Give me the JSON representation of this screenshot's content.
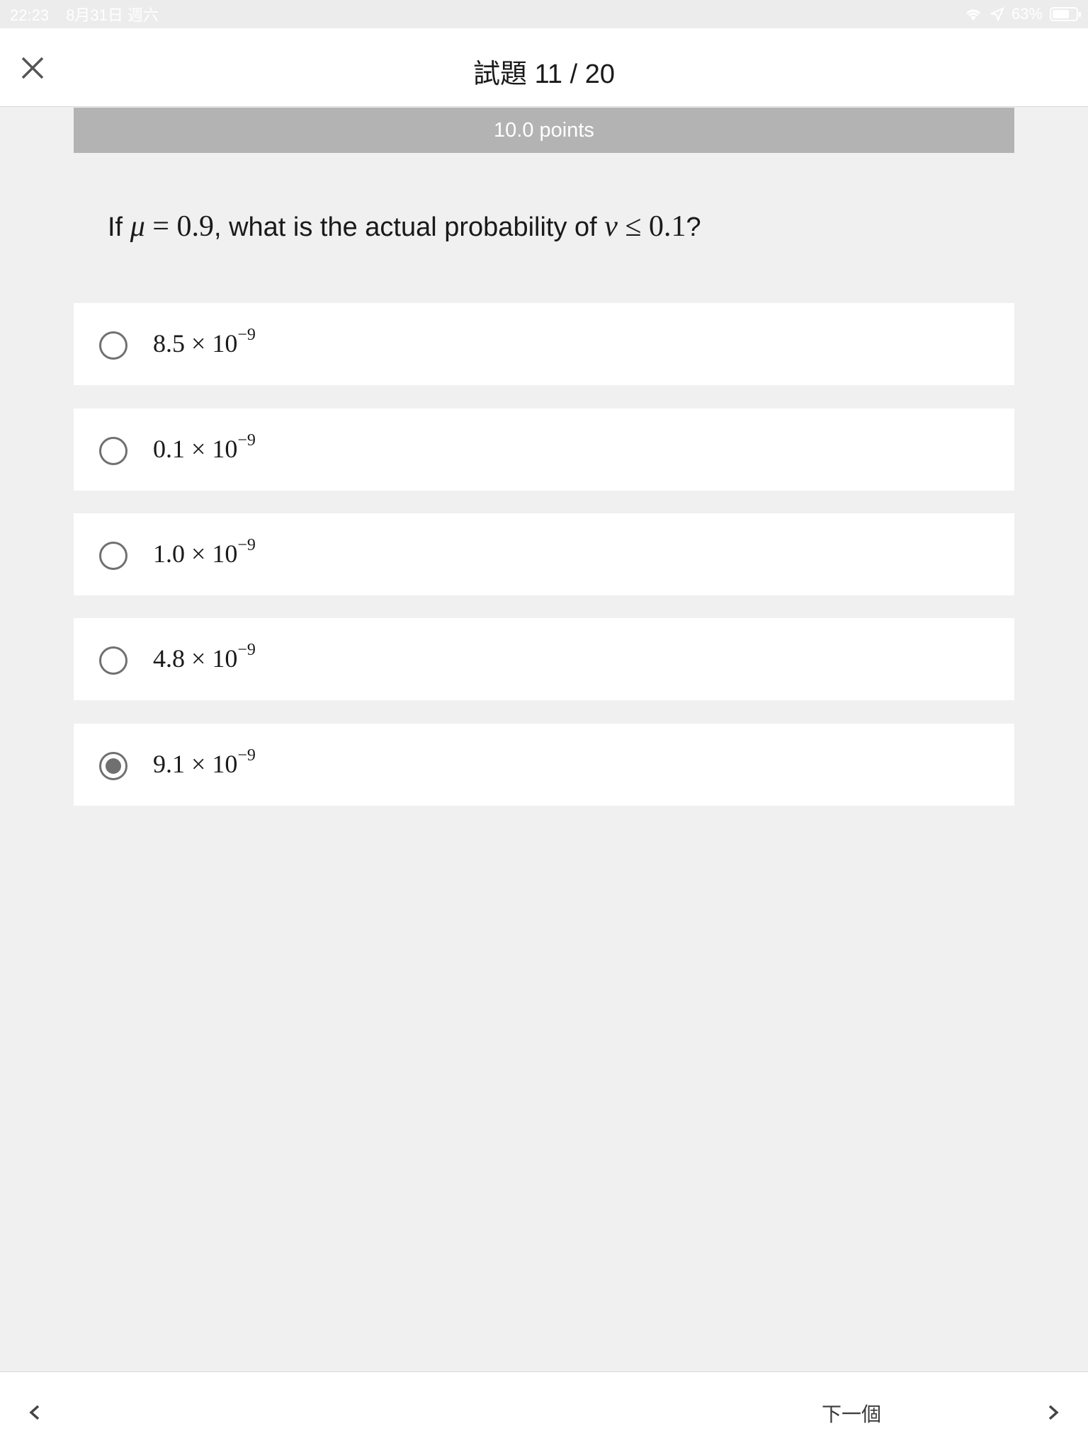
{
  "status_bar": {
    "time": "22:23",
    "date": "8月31日 週六",
    "battery": "63%"
  },
  "header": {
    "title": "試題 11 / 20"
  },
  "points": "10.0 points",
  "question": {
    "prefix": "If ",
    "var1": "μ",
    "eq": " = 0.9",
    "middle": ", what is the actual probability of ",
    "var2": "ν",
    "ineq": " ≤ 0.1",
    "suffix": "?"
  },
  "options": [
    {
      "mantissa": "8.5",
      "times": "×",
      "base": "10",
      "exp": "−9",
      "selected": false
    },
    {
      "mantissa": "0.1",
      "times": "×",
      "base": "10",
      "exp": "−9",
      "selected": false
    },
    {
      "mantissa": "1.0",
      "times": "×",
      "base": "10",
      "exp": "−9",
      "selected": false
    },
    {
      "mantissa": "4.8",
      "times": "×",
      "base": "10",
      "exp": "−9",
      "selected": false
    },
    {
      "mantissa": "9.1",
      "times": "×",
      "base": "10",
      "exp": "−9",
      "selected": true
    }
  ],
  "footer": {
    "next_label": "下一個"
  }
}
